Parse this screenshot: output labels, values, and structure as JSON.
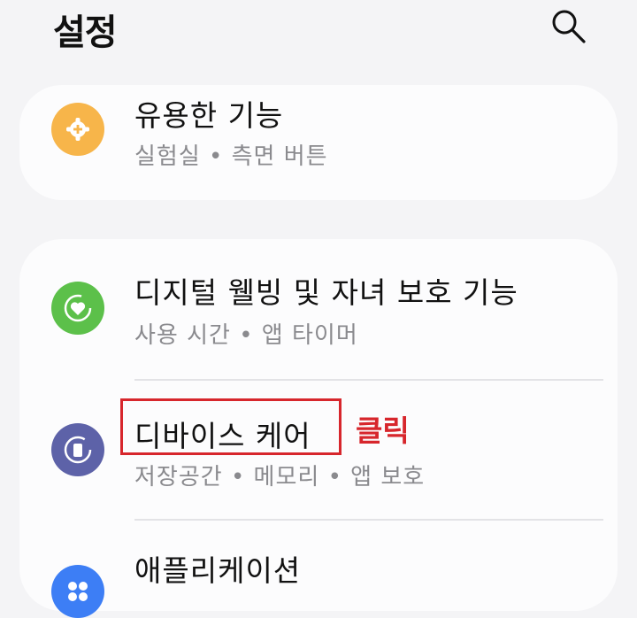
{
  "header": {
    "title": "설정",
    "search_icon": "search-icon"
  },
  "items": [
    {
      "title": "유용한 기능",
      "subtitle": "실험실  •  측면 버튼",
      "icon": "plus-gear-icon",
      "color": "#f7b54a"
    },
    {
      "title": "디지털 웰빙 및 자녀 보호 기능",
      "subtitle": "사용 시간  •  앱 타이머",
      "icon": "heart-cycle-icon",
      "color": "#5cc04a"
    },
    {
      "title": "디바이스 케어",
      "subtitle": "저장공간  •  메모리  •  앱 보호",
      "icon": "device-care-icon",
      "color": "#5d62a8"
    },
    {
      "title": "애플리케이션",
      "subtitle": "",
      "icon": "apps-icon",
      "color": "#3d7ef5"
    }
  ],
  "annotation": {
    "label": "클릭",
    "color": "#d7262c"
  }
}
